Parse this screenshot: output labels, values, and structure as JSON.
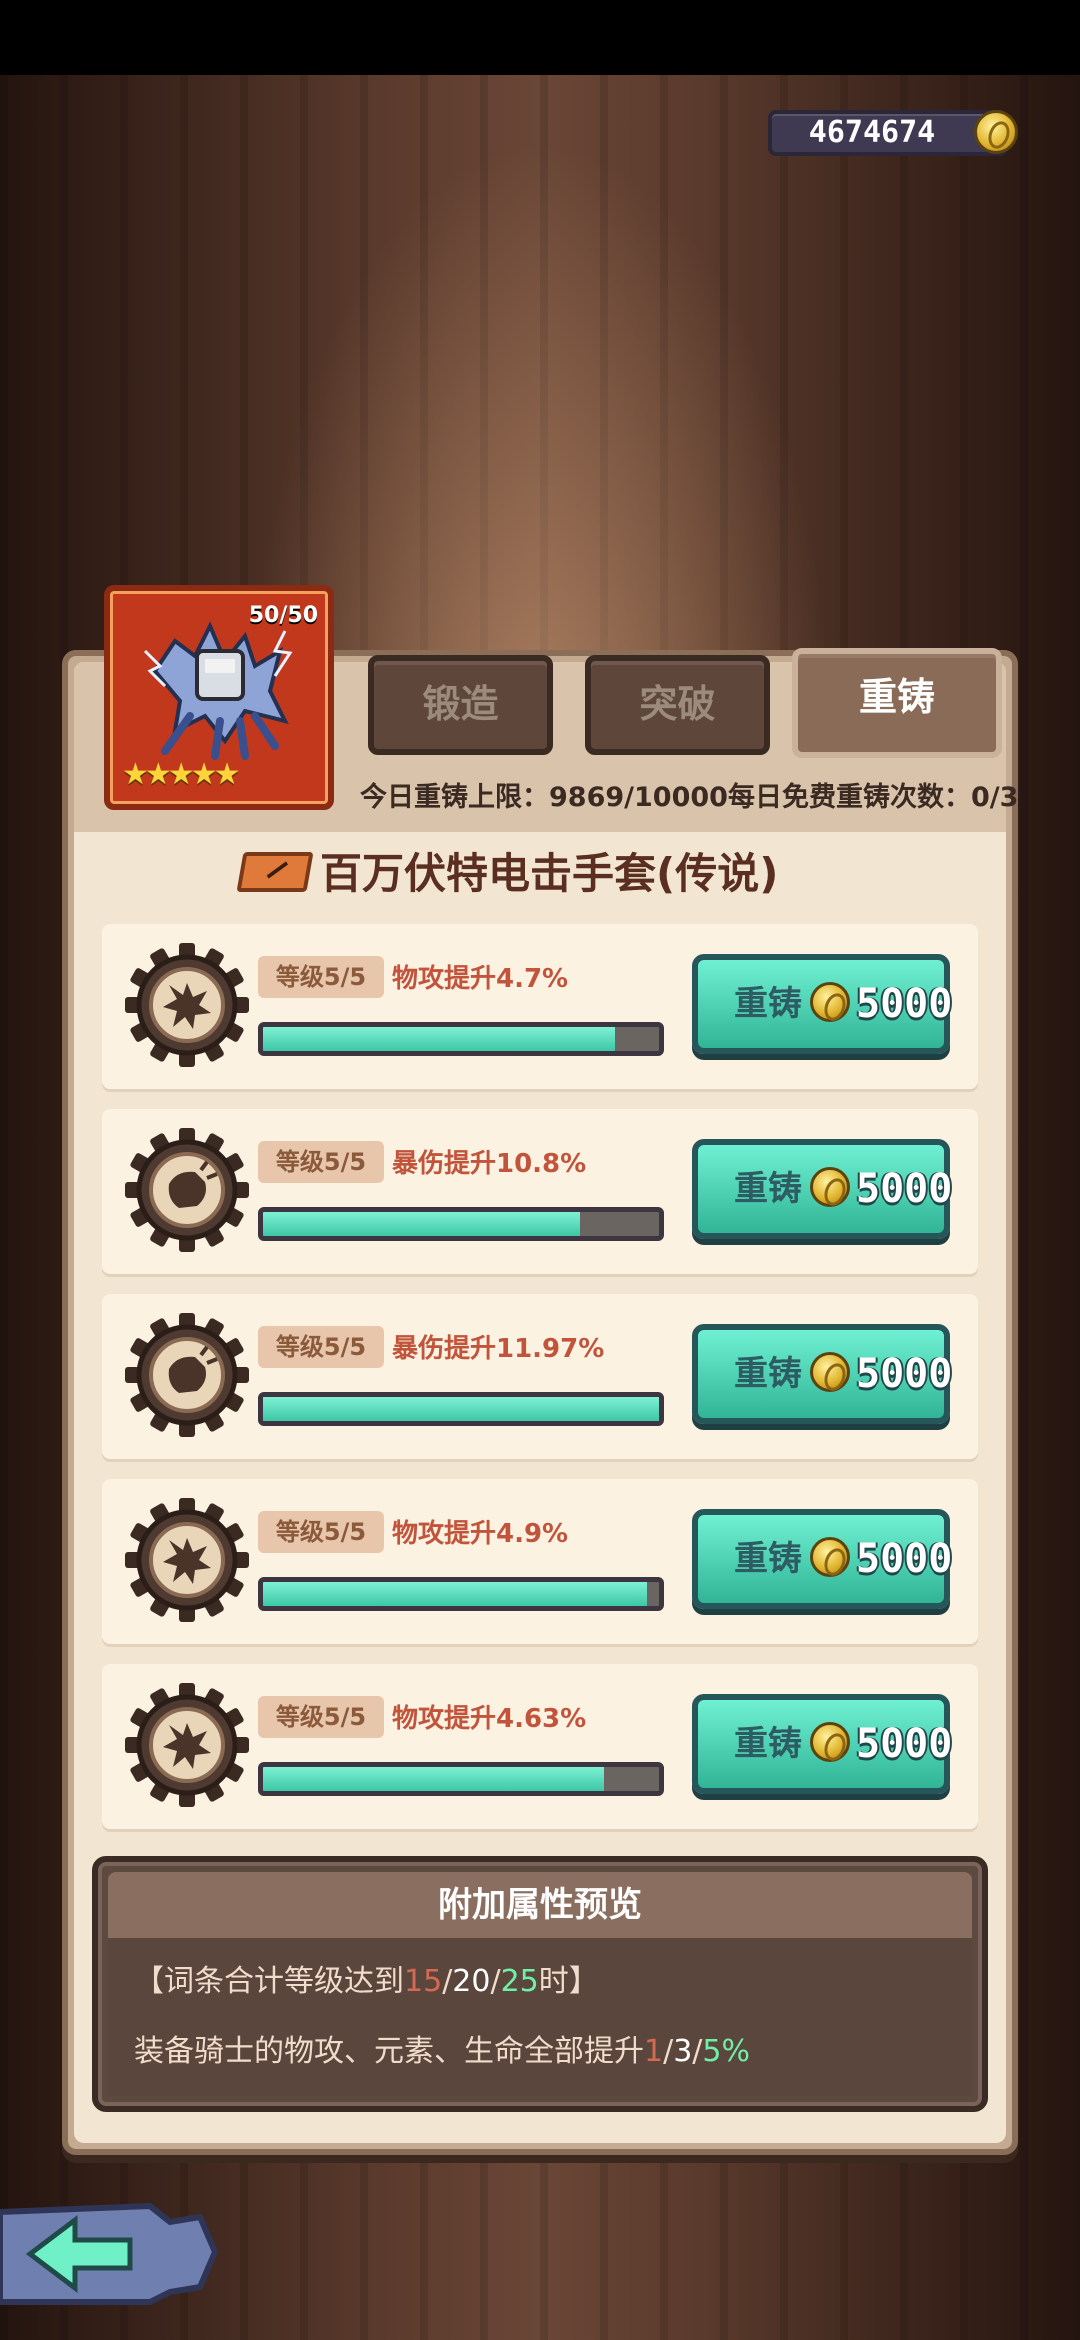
{
  "currency": {
    "amount": "4674674",
    "icon": "gold-coin-icon"
  },
  "item": {
    "level": "50/50",
    "stars": "★★★★★",
    "name": "百万伏特电击手套(传说)",
    "icon": "lightning-gauntlet-icon"
  },
  "tabs": [
    {
      "label": "锻造",
      "active": false
    },
    {
      "label": "突破",
      "active": false
    },
    {
      "label": "重铸",
      "active": true
    }
  ],
  "reforge_info": {
    "text": "今日重铸上限：9869/10000每日免费重铸次数：0/3"
  },
  "stats": [
    {
      "level": "等级5/5",
      "effect": "物攻提升4.7%",
      "progress": 0.89,
      "icon": "explosion-gear-icon",
      "button_label": "重铸",
      "cost": "5000"
    },
    {
      "level": "等级5/5",
      "effect": "暴伤提升10.8%",
      "progress": 0.8,
      "icon": "crit-fist-gear-icon",
      "button_label": "重铸",
      "cost": "5000"
    },
    {
      "level": "等级5/5",
      "effect": "暴伤提升11.97%",
      "progress": 1.0,
      "icon": "crit-fist-gear-icon",
      "button_label": "重铸",
      "cost": "5000"
    },
    {
      "level": "等级5/5",
      "effect": "物攻提升4.9%",
      "progress": 0.97,
      "icon": "explosion-gear-icon",
      "button_label": "重铸",
      "cost": "5000"
    },
    {
      "level": "等级5/5",
      "effect": "物攻提升4.63%",
      "progress": 0.86,
      "icon": "explosion-gear-icon",
      "button_label": "重铸",
      "cost": "5000"
    }
  ],
  "preview": {
    "title": "附加属性预览",
    "cond_prefix": "【词条合计等级达到",
    "cond_a": "15",
    "sep1": "/",
    "cond_b": "20",
    "sep2": "/",
    "cond_c": "25",
    "cond_suffix": "时】",
    "bonus_prefix": "装备骑士的物攻、元素、生命全部提升",
    "bonus_a": "1",
    "sep3": "/",
    "bonus_b": "3",
    "sep4": "/",
    "bonus_c": "5%"
  },
  "colors": {
    "accent_button": "#3cc8a6",
    "progress_fill": "#3cc8a6",
    "stat_text": "#c2543c",
    "legendary_card": "#c1381c"
  }
}
